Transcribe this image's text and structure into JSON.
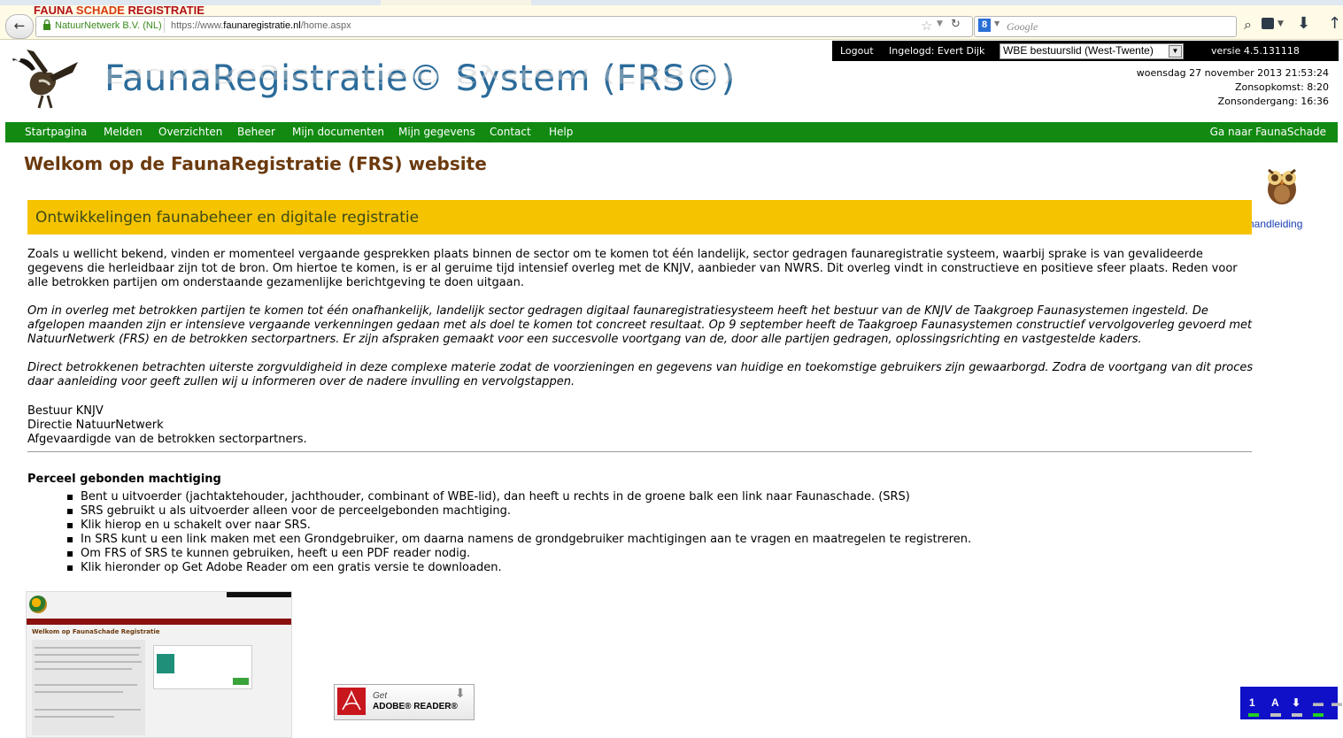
{
  "browser": {
    "site_identity": "NatuurNetwerk B.V. (NL)",
    "url_prefix": "https://www.",
    "url_domain": "faunaregistratie.nl",
    "url_path": "/home.aspx",
    "search_placeholder": "Google",
    "back_icon": "back-arrow-icon",
    "colors": {
      "identity_green": "#3a8a1c",
      "chrome_bg": "#fffbe6"
    }
  },
  "header": {
    "site_title": "FaunaRegistratie© System (FRS©)",
    "logout": "Logout",
    "logged_in": "Ingelogd: Evert Dijk",
    "role_selected": "WBE bestuurslid (West-Twente)",
    "version": "versie 4.5.131118",
    "datetime": "woensdag 27 november 2013 21:53:24",
    "sunrise": "Zonsopkomst: 8:20",
    "sunset": "Zonsondergang: 16:36",
    "colors": {
      "title": "#2b6b9a",
      "user_bar": "#000000"
    }
  },
  "nav": {
    "items": [
      {
        "label": "Startpagina"
      },
      {
        "label": "Melden"
      },
      {
        "label": "Overzichten"
      },
      {
        "label": "Beheer"
      },
      {
        "label": "Mijn documenten"
      },
      {
        "label": "Mijn gegevens"
      },
      {
        "label": "Contact"
      },
      {
        "label": "Help"
      }
    ],
    "right_link": "Ga naar FaunaSchade",
    "color": "#128a12"
  },
  "main": {
    "page_title": "Welkom op de FaunaRegistratie (FRS) website",
    "manual_link": "handleiding",
    "banner_title": "Ontwikkelingen faunabeheer en digitale registratie",
    "banner_color": "#f5c300",
    "paragraph1": "Zoals u wellicht bekend, vinden er momenteel vergaande gesprekken plaats binnen de sector om te komen tot één landelijk, sector gedragen faunaregistratie systeem, waarbij sprake is van gevalideerde gegevens die herleidbaar zijn tot de bron. Om hiertoe te komen, is er al geruime tijd intensief overleg met de KNJV, aanbieder van NWRS. Dit overleg vindt in constructieve en positieve sfeer plaats. Reden voor alle betrokken partijen om onderstaande gezamenlijke berichtgeving te doen uitgaan.",
    "paragraph2": "Om in overleg met betrokken partijen te komen tot één onafhankelijk, landelijk sector gedragen digitaal faunaregistratiesysteem heeft het bestuur van de KNJV de Taakgroep Faunasystemen ingesteld. De afgelopen maanden zijn er intensieve vergaande verkenningen gedaan met als doel te komen tot concreet resultaat. Op 9 september heeft de Taakgroep Faunasystemen constructief vervolgoverleg gevoerd met NatuurNetwerk (FRS) en de betrokken sectorpartners. Er zijn afspraken gemaakt voor een succesvolle voortgang van de, door alle partijen gedragen, oplossingsrichting en vastgestelde kaders.",
    "paragraph3": "Direct betrokkenen betrachten uiterste zorgvuldigheid in deze complexe materie zodat de voorzieningen en gegevens van huidige en toekomstige gebruikers zijn gewaarborgd. Zodra de voortgang van dit proces daar aanleiding voor geeft zullen wij u informeren over de nadere invulling en vervolgstappen.",
    "signature_lines": [
      "Bestuur KNJV",
      "Directie NatuurNetwerk",
      "Afgevaardigde van de betrokken sectorpartners."
    ],
    "section_heading": "Perceel gebonden machtiging",
    "bullets": [
      "Bent u uitvoerder (jachtaktehouder, jachthouder, combinant of WBE-lid), dan heeft u rechts in de groene balk een link naar Faunaschade. (SRS)",
      "SRS gebruikt u als uitvoerder alleen voor de perceelgebonden machtiging.",
      "Klik hierop en u schakelt over naar SRS.",
      "In SRS kunt u een link maken met een Grondgebruiker, om daarna namens de grondgebruiker machtigingen aan te vragen en maatregelen te registreren.",
      "Om FRS of SRS te kunnen gebruiken, heeft u een PDF reader nodig.",
      "Klik hieronder op Get Adobe Reader om een gratis versie te downloaden."
    ],
    "thumbnail": {
      "logo_fauna": "FAUNA",
      "logo_schade": "SCHADE",
      "logo_registratie": "REGISTRATIE",
      "title": "Welkom op FaunaSchade Registratie"
    },
    "adobe": {
      "get": "Get",
      "reader": "ADOBE® READER®"
    }
  },
  "tray": {
    "items": [
      "1",
      "A",
      "⬇",
      "▬",
      "▬"
    ]
  }
}
